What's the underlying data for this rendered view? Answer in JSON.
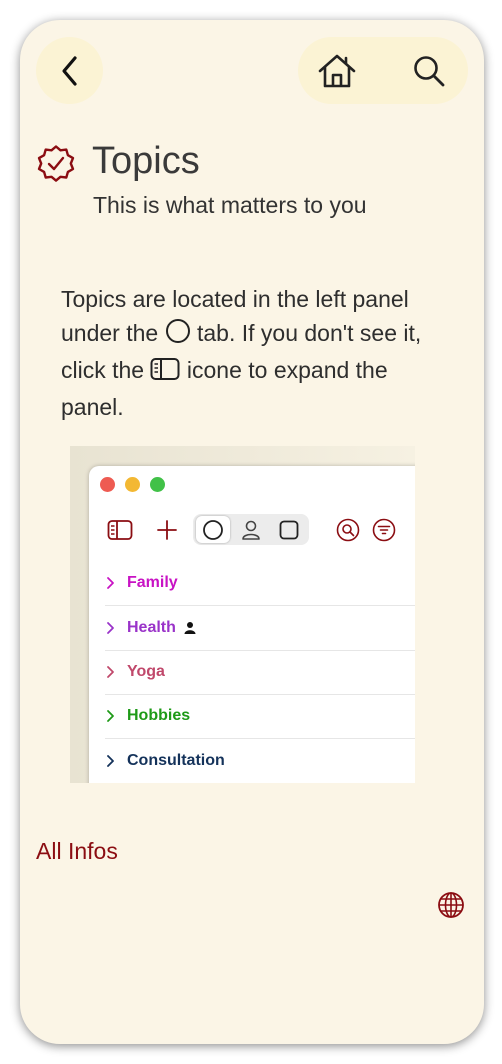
{
  "header": {
    "back_icon": "chevron-left-icon",
    "home_icon": "house-icon",
    "search_icon": "magnifier-icon",
    "badge_icon": "checkmark-seal-icon",
    "title": "Topics",
    "subtitle": "This is what matters to you"
  },
  "intro": {
    "part1": "Topics are located in the left panel under the ",
    "part2": " tab. If you don't see it, click the ",
    "part3": " icone to expand the panel.",
    "tab_icon": "circle-icon",
    "panel_icon": "sidebar-icon"
  },
  "preview": {
    "toolbar": {
      "sidebar_icon": "sidebar-icon",
      "add_icon": "plus-icon",
      "segments": [
        "circle-icon",
        "person-icon",
        "square-icon"
      ],
      "search_icon": "magnifier-circle-icon",
      "filter_icon": "filter-circle-icon"
    },
    "topics": [
      {
        "label": "Family",
        "color": "#c813c4"
      },
      {
        "label": "Health",
        "color": "#9a33c9",
        "badge_icon": "person-icon"
      },
      {
        "label": "Yoga",
        "color": "#c0486b"
      },
      {
        "label": "Hobbies",
        "color": "#1e9a17"
      },
      {
        "label": "Consultation",
        "color": "#14325a"
      }
    ]
  },
  "footer": {
    "all_infos": "All Infos",
    "globe_icon": "globe-icon"
  },
  "colors": {
    "accent": "#8b0d12",
    "background": "#fbf5e6",
    "button_bg": "#fbf3d4"
  }
}
